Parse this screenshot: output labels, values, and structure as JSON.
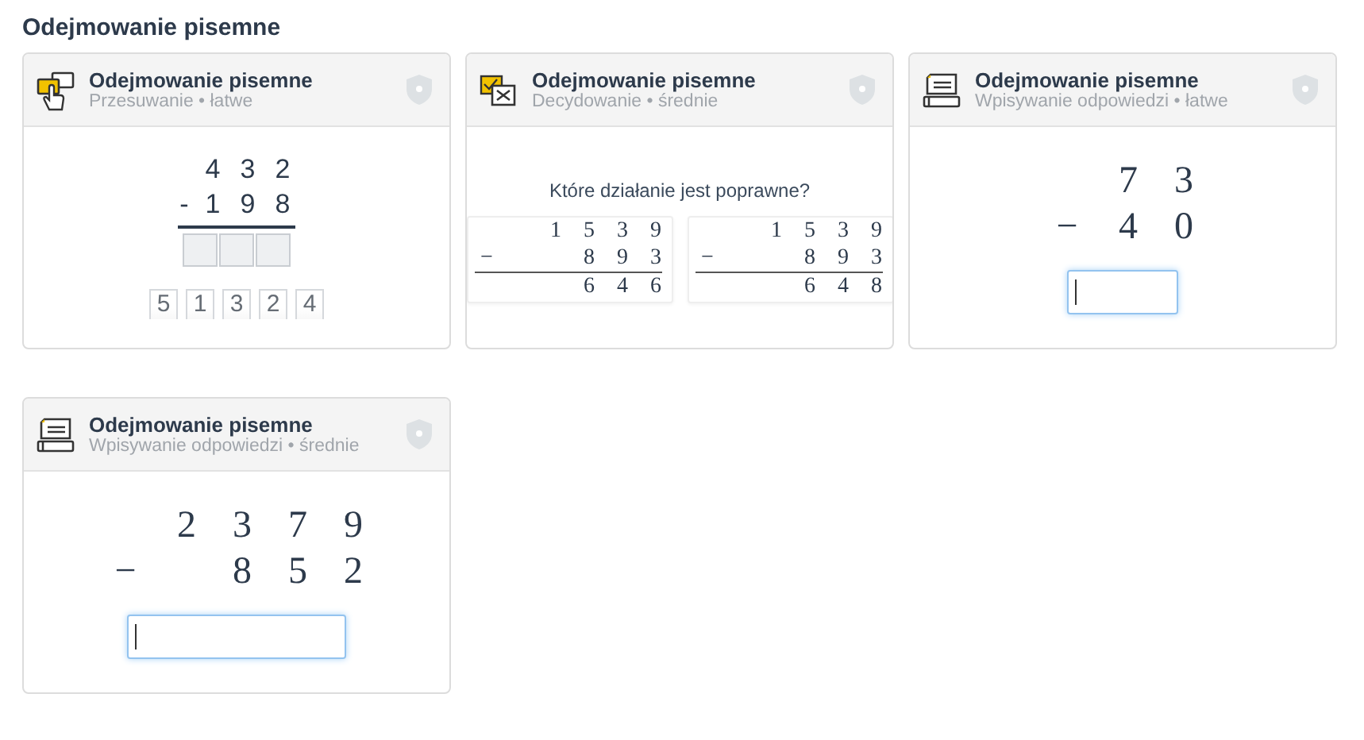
{
  "heading": "Odejmowanie pisemne",
  "cards": [
    {
      "kind": "drag",
      "title": "Odejmowanie pisemne",
      "subtitle": "Przesuwanie • łatwe",
      "minuend": [
        "4",
        "3",
        "2"
      ],
      "sign": "-",
      "subtrahend": [
        "1",
        "9",
        "8"
      ],
      "tiles": [
        "5",
        "1",
        "3",
        "2",
        "4"
      ]
    },
    {
      "kind": "choice",
      "title": "Odejmowanie pisemne",
      "subtitle": "Decydowanie • średnie",
      "question": "Które działanie jest poprawne?",
      "options": [
        {
          "minuend": [
            "1",
            "5",
            "3",
            "9"
          ],
          "sign": "−",
          "subtrahend": [
            "8",
            "9",
            "3"
          ],
          "result": [
            "6",
            "4",
            "6"
          ]
        },
        {
          "minuend": [
            "1",
            "5",
            "3",
            "9"
          ],
          "sign": "−",
          "subtrahend": [
            "8",
            "9",
            "3"
          ],
          "result": [
            "6",
            "4",
            "8"
          ]
        }
      ]
    },
    {
      "kind": "input",
      "title": "Odejmowanie pisemne",
      "subtitle": "Wpisywanie odpowiedzi • łatwe",
      "minuend": [
        "7",
        "3"
      ],
      "sign": "−",
      "subtrahend": [
        "4",
        "0"
      ],
      "focused": true
    },
    {
      "kind": "input",
      "title": "Odejmowanie pisemne",
      "subtitle": "Wpisywanie odpowiedzi • średnie",
      "minuend": [
        "2",
        "3",
        "7",
        "9"
      ],
      "sign": "−",
      "subtrahend": [
        "8",
        "5",
        "2"
      ],
      "focused": true
    }
  ]
}
